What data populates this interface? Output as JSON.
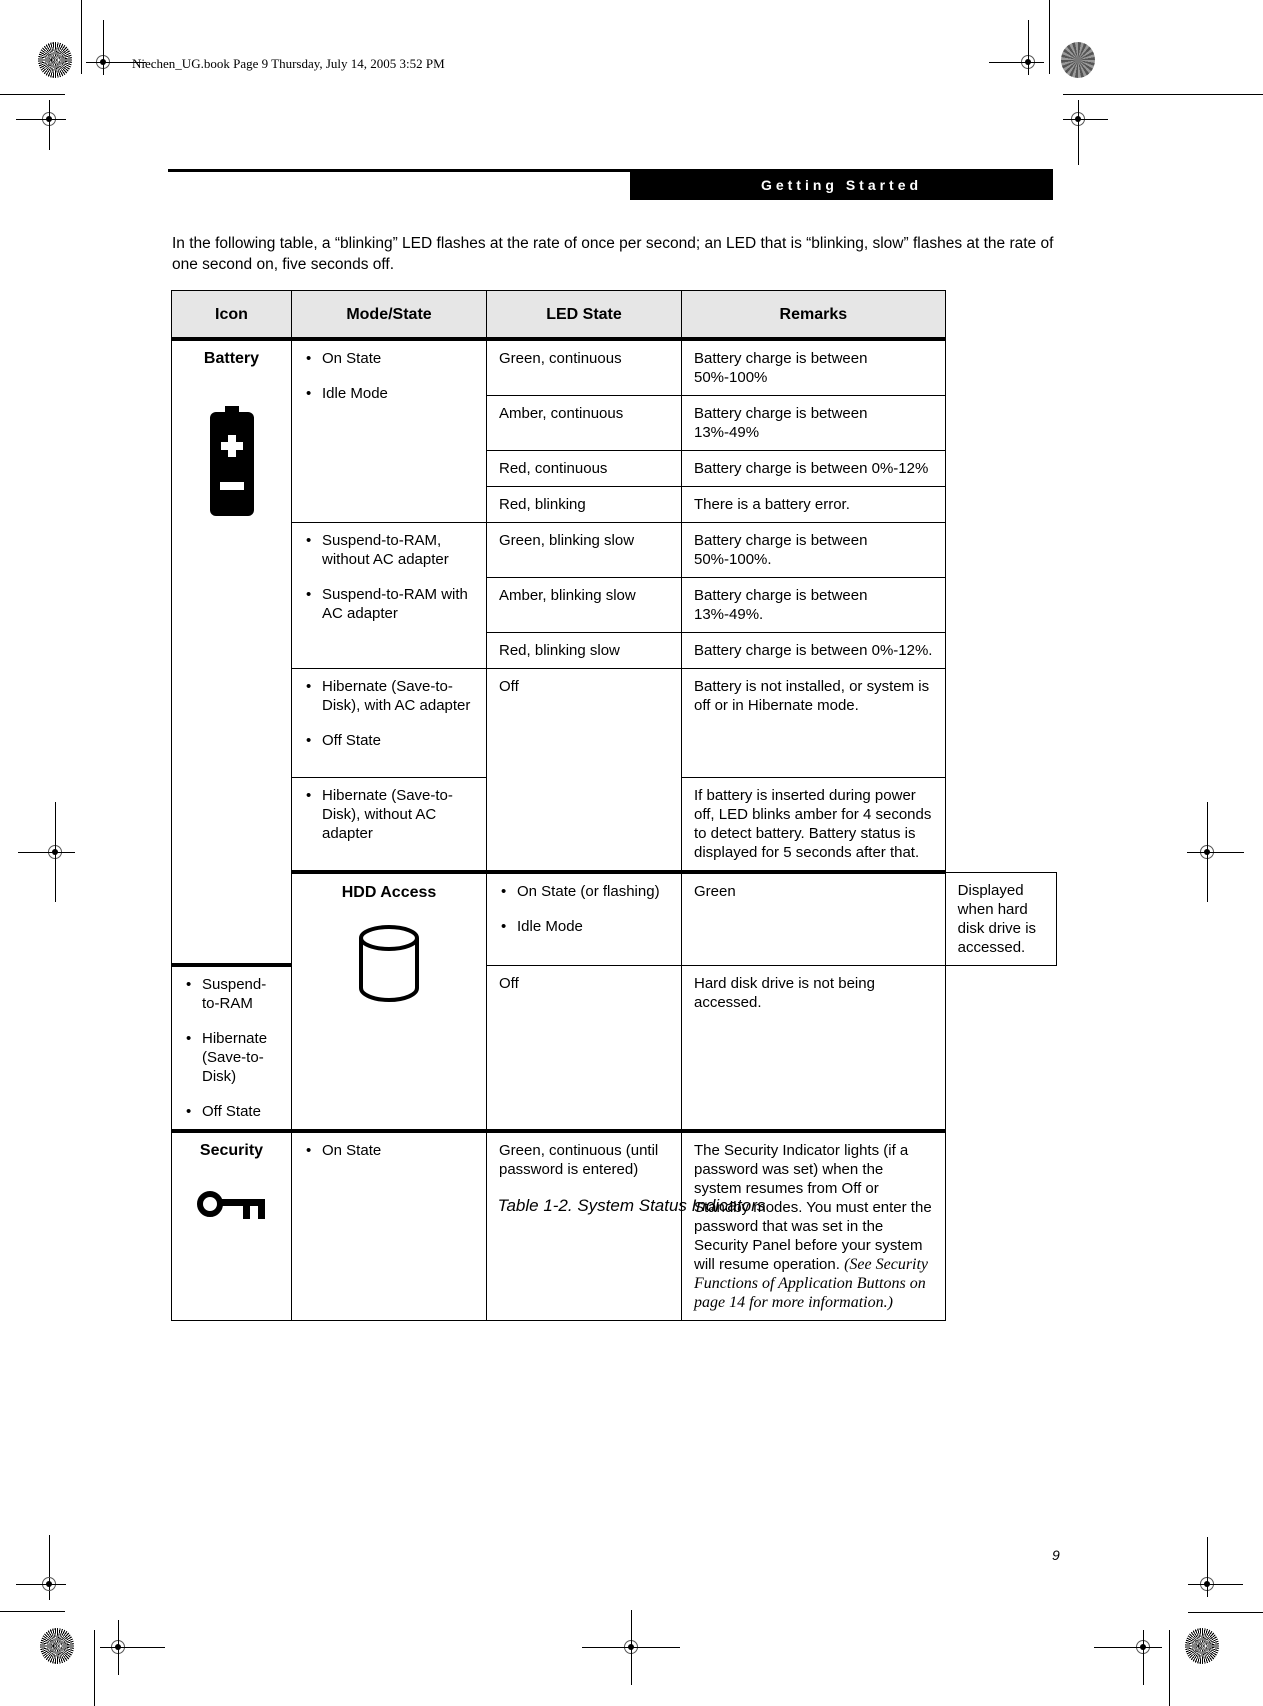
{
  "print_slug": "Niechen_UG.book  Page 9  Thursday, July 14, 2005  3:52 PM",
  "header": {
    "section_title": "Getting Started"
  },
  "intro": "In the following table, a “blinking” LED flashes at the rate of once per second; an LED that is “blinking, slow” flashes at the rate of one second on, five seconds off.",
  "table": {
    "columns": [
      "Icon",
      "Mode/State",
      "LED State",
      "Remarks"
    ],
    "battery": {
      "label": "Battery",
      "icon": "battery-icon",
      "groups": [
        {
          "modes": [
            "On State",
            "Idle Mode"
          ],
          "rows": [
            {
              "led": "Green, continuous",
              "remark": "Battery charge is between 50%-100%"
            },
            {
              "led": "Amber, continuous",
              "remark": "Battery charge is between 13%-49%"
            },
            {
              "led": "Red, continuous",
              "remark": "Battery charge is between 0%-12%"
            },
            {
              "led": "Red, blinking",
              "remark": "There is a battery error."
            }
          ]
        },
        {
          "modes": [
            "Suspend-to-RAM, without AC adapter",
            "Suspend-to-RAM with AC adapter"
          ],
          "rows": [
            {
              "led": "Green, blinking slow",
              "remark": "Battery charge is between 50%-100%."
            },
            {
              "led": "Amber, blinking slow",
              "remark": "Battery charge is between 13%-49%."
            },
            {
              "led": "Red, blinking slow",
              "remark": "Battery charge is between 0%-12%."
            }
          ]
        },
        {
          "modes": [
            "Hibernate (Save-to-Disk), with AC adapter",
            "Off State"
          ],
          "led": "Off",
          "remark": "Battery is not installed, or system is off or in Hibernate mode."
        },
        {
          "modes": [
            "Hibernate (Save-to-Disk), without AC adapter"
          ],
          "remark": "If battery is inserted during power off, LED blinks amber for 4 seconds to detect battery. Battery status is displayed for 5 seconds after that."
        }
      ]
    },
    "hdd": {
      "label": "HDD Access",
      "icon": "hard-disk-icon",
      "groups": [
        {
          "modes": [
            "On State (or flashing)",
            "Idle Mode"
          ],
          "led": "Green",
          "remark": "Displayed when hard disk drive is accessed."
        },
        {
          "modes": [
            "Suspend-to-RAM",
            "Hibernate (Save-to-Disk)",
            "Off State"
          ],
          "led": "Off",
          "remark": "Hard disk drive is not being accessed."
        }
      ]
    },
    "security": {
      "label": "Security",
      "icon": "key-icon",
      "modes": [
        "On State"
      ],
      "led": "Green, continuous (until password is entered)",
      "remark": "The Security Indicator lights (if a password was set) when the system resumes from Off or Standby modes. You must enter the password that was set in the Security Panel before your system will resume operation.",
      "remark_ref": "(See Security Functions of Application Buttons on page 14 for more information.)"
    }
  },
  "caption": "Table 1-2. System Status Indicators",
  "page_number": "9"
}
